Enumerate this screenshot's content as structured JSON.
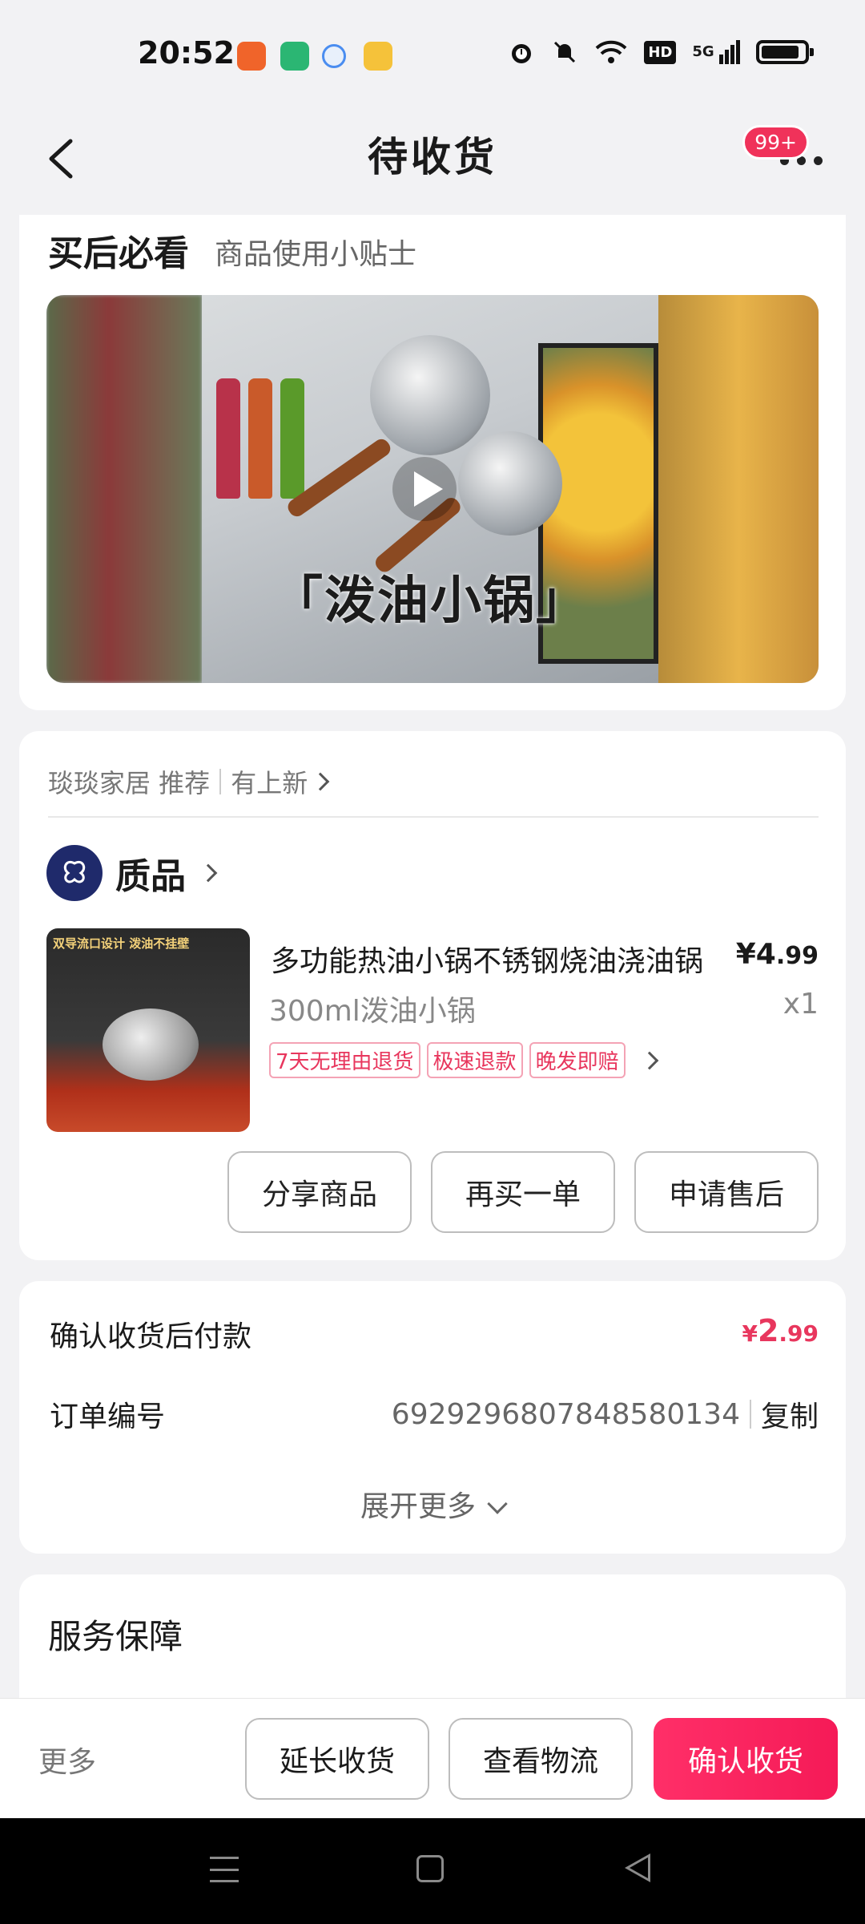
{
  "status_bar": {
    "time": "20:52",
    "app_icons": [
      {
        "name": "app-icon-orange",
        "color": "#f0642a"
      },
      {
        "name": "app-icon-green",
        "color": "#2bb673"
      },
      {
        "name": "app-icon-search",
        "color": "#4a8df0"
      },
      {
        "name": "app-icon-yellow",
        "color": "#f5c23a"
      }
    ],
    "network_label": "HD",
    "signal_label": "5G"
  },
  "nav": {
    "title": "待收货",
    "badge": "99+"
  },
  "tips": {
    "title": "买后必看",
    "subtitle": "商品使用小贴士",
    "video_caption": "「泼油小锅」"
  },
  "shop": {
    "name": "琰琰家居 推荐",
    "new_label": "有上新",
    "brand_name": "质品",
    "brand_logo_text": "质品"
  },
  "product": {
    "image_text": "双导流口设计 泼油不挂壁",
    "name": "多功能热油小锅不锈钢烧油浇油锅",
    "price_symbol": "¥",
    "price_int": "4",
    "price_dec": ".99",
    "spec": "300ml泼油小锅",
    "qty": "x1",
    "tags": [
      "7天无理由退货",
      "极速退款",
      "晚发即赔"
    ],
    "actions": [
      "分享商品",
      "再买一单",
      "申请售后"
    ]
  },
  "payment": {
    "label": "确认收货后付款",
    "amount_symbol": "¥",
    "amount_int": "2",
    "amount_dec": ".99",
    "order_label": "订单编号",
    "order_number": "6929296807848580134",
    "copy_label": "复制",
    "expand_label": "展开更多"
  },
  "service": {
    "title": "服务保障"
  },
  "bottom_bar": {
    "more": "更多",
    "extend": "延长收货",
    "logistics": "查看物流",
    "confirm": "确认收货"
  },
  "colors": {
    "accent": "#f0325a",
    "background": "#f2f2f4"
  }
}
